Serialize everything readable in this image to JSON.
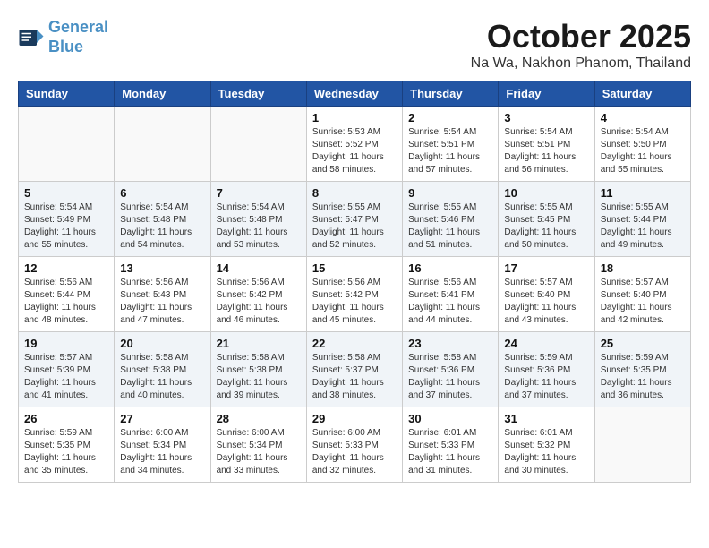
{
  "header": {
    "logo_line1": "General",
    "logo_line2": "Blue",
    "month_title": "October 2025",
    "location": "Na Wa, Nakhon Phanom, Thailand"
  },
  "days_of_week": [
    "Sunday",
    "Monday",
    "Tuesday",
    "Wednesday",
    "Thursday",
    "Friday",
    "Saturday"
  ],
  "weeks": [
    [
      {
        "day": "",
        "info": ""
      },
      {
        "day": "",
        "info": ""
      },
      {
        "day": "",
        "info": ""
      },
      {
        "day": "1",
        "info": "Sunrise: 5:53 AM\nSunset: 5:52 PM\nDaylight: 11 hours and 58 minutes."
      },
      {
        "day": "2",
        "info": "Sunrise: 5:54 AM\nSunset: 5:51 PM\nDaylight: 11 hours and 57 minutes."
      },
      {
        "day": "3",
        "info": "Sunrise: 5:54 AM\nSunset: 5:51 PM\nDaylight: 11 hours and 56 minutes."
      },
      {
        "day": "4",
        "info": "Sunrise: 5:54 AM\nSunset: 5:50 PM\nDaylight: 11 hours and 55 minutes."
      }
    ],
    [
      {
        "day": "5",
        "info": "Sunrise: 5:54 AM\nSunset: 5:49 PM\nDaylight: 11 hours and 55 minutes."
      },
      {
        "day": "6",
        "info": "Sunrise: 5:54 AM\nSunset: 5:48 PM\nDaylight: 11 hours and 54 minutes."
      },
      {
        "day": "7",
        "info": "Sunrise: 5:54 AM\nSunset: 5:48 PM\nDaylight: 11 hours and 53 minutes."
      },
      {
        "day": "8",
        "info": "Sunrise: 5:55 AM\nSunset: 5:47 PM\nDaylight: 11 hours and 52 minutes."
      },
      {
        "day": "9",
        "info": "Sunrise: 5:55 AM\nSunset: 5:46 PM\nDaylight: 11 hours and 51 minutes."
      },
      {
        "day": "10",
        "info": "Sunrise: 5:55 AM\nSunset: 5:45 PM\nDaylight: 11 hours and 50 minutes."
      },
      {
        "day": "11",
        "info": "Sunrise: 5:55 AM\nSunset: 5:44 PM\nDaylight: 11 hours and 49 minutes."
      }
    ],
    [
      {
        "day": "12",
        "info": "Sunrise: 5:56 AM\nSunset: 5:44 PM\nDaylight: 11 hours and 48 minutes."
      },
      {
        "day": "13",
        "info": "Sunrise: 5:56 AM\nSunset: 5:43 PM\nDaylight: 11 hours and 47 minutes."
      },
      {
        "day": "14",
        "info": "Sunrise: 5:56 AM\nSunset: 5:42 PM\nDaylight: 11 hours and 46 minutes."
      },
      {
        "day": "15",
        "info": "Sunrise: 5:56 AM\nSunset: 5:42 PM\nDaylight: 11 hours and 45 minutes."
      },
      {
        "day": "16",
        "info": "Sunrise: 5:56 AM\nSunset: 5:41 PM\nDaylight: 11 hours and 44 minutes."
      },
      {
        "day": "17",
        "info": "Sunrise: 5:57 AM\nSunset: 5:40 PM\nDaylight: 11 hours and 43 minutes."
      },
      {
        "day": "18",
        "info": "Sunrise: 5:57 AM\nSunset: 5:40 PM\nDaylight: 11 hours and 42 minutes."
      }
    ],
    [
      {
        "day": "19",
        "info": "Sunrise: 5:57 AM\nSunset: 5:39 PM\nDaylight: 11 hours and 41 minutes."
      },
      {
        "day": "20",
        "info": "Sunrise: 5:58 AM\nSunset: 5:38 PM\nDaylight: 11 hours and 40 minutes."
      },
      {
        "day": "21",
        "info": "Sunrise: 5:58 AM\nSunset: 5:38 PM\nDaylight: 11 hours and 39 minutes."
      },
      {
        "day": "22",
        "info": "Sunrise: 5:58 AM\nSunset: 5:37 PM\nDaylight: 11 hours and 38 minutes."
      },
      {
        "day": "23",
        "info": "Sunrise: 5:58 AM\nSunset: 5:36 PM\nDaylight: 11 hours and 37 minutes."
      },
      {
        "day": "24",
        "info": "Sunrise: 5:59 AM\nSunset: 5:36 PM\nDaylight: 11 hours and 37 minutes."
      },
      {
        "day": "25",
        "info": "Sunrise: 5:59 AM\nSunset: 5:35 PM\nDaylight: 11 hours and 36 minutes."
      }
    ],
    [
      {
        "day": "26",
        "info": "Sunrise: 5:59 AM\nSunset: 5:35 PM\nDaylight: 11 hours and 35 minutes."
      },
      {
        "day": "27",
        "info": "Sunrise: 6:00 AM\nSunset: 5:34 PM\nDaylight: 11 hours and 34 minutes."
      },
      {
        "day": "28",
        "info": "Sunrise: 6:00 AM\nSunset: 5:34 PM\nDaylight: 11 hours and 33 minutes."
      },
      {
        "day": "29",
        "info": "Sunrise: 6:00 AM\nSunset: 5:33 PM\nDaylight: 11 hours and 32 minutes."
      },
      {
        "day": "30",
        "info": "Sunrise: 6:01 AM\nSunset: 5:33 PM\nDaylight: 11 hours and 31 minutes."
      },
      {
        "day": "31",
        "info": "Sunrise: 6:01 AM\nSunset: 5:32 PM\nDaylight: 11 hours and 30 minutes."
      },
      {
        "day": "",
        "info": ""
      }
    ]
  ]
}
